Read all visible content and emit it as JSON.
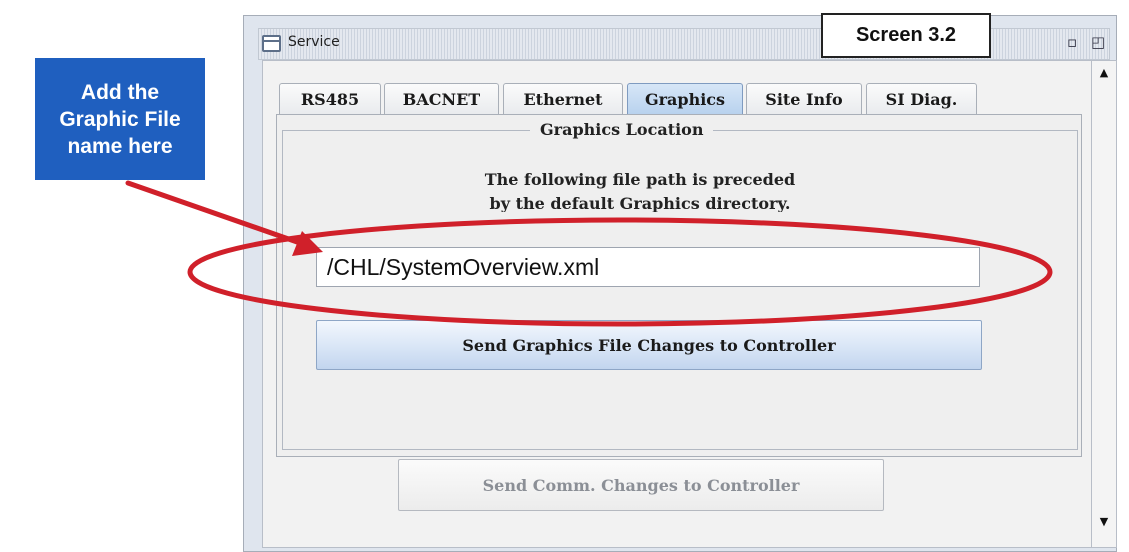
{
  "callout": {
    "lines": [
      "Add the",
      "Graphic File",
      "name here"
    ]
  },
  "screen_label": "Screen 3.2",
  "window": {
    "title": "Service"
  },
  "tabs": [
    {
      "label": "RS485",
      "active": false
    },
    {
      "label": "BACNET",
      "active": false
    },
    {
      "label": "Ethernet",
      "active": false
    },
    {
      "label": "Graphics",
      "active": true
    },
    {
      "label": "Site Info",
      "active": false
    },
    {
      "label": "SI Diag.",
      "active": false
    }
  ],
  "graphics": {
    "group_title": "Graphics Location",
    "description_line1": "The following file path is preceded",
    "description_line2": "by the default Graphics directory.",
    "path_value": "/CHL/SystemOverview.xml",
    "send_button": "Send Graphics File Changes to Controller"
  },
  "footer": {
    "send_comm_button": "Send Comm. Changes to Controller"
  },
  "annotation_colors": {
    "arrow": "#d0202a",
    "ellipse": "#d0202a",
    "callout_bg": "#1f5fbf"
  }
}
